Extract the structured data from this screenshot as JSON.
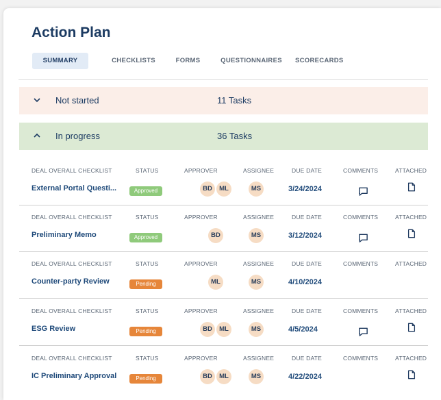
{
  "title": "Action Plan",
  "tabs": [
    "SUMMARY",
    "CHECKLISTS",
    "FORMS",
    "QUESTIONNAIRES",
    "SCORECARDS"
  ],
  "active_tab": "SUMMARY",
  "groups": [
    {
      "label": "Not started",
      "count": "11 Tasks",
      "expanded": false,
      "color": "#fbeee8"
    },
    {
      "label": "In progress",
      "count": "36 Tasks",
      "expanded": true,
      "color": "#dcead4"
    }
  ],
  "columns": {
    "checklist": "DEAL OVERALL CHECKLIST",
    "status": "STATUS",
    "approver": "APPROVER",
    "assignee": "ASSIGNEE",
    "due": "DUE DATE",
    "comments": "COMMENTS",
    "attached": "ATTACHED"
  },
  "status_colors": {
    "Approved": "#8fca7b",
    "Pending": "#e6863a"
  },
  "rows": [
    {
      "name": "External Portal Questi...",
      "status": "Approved",
      "approvers": [
        "BD",
        "ML"
      ],
      "assignee": "MS",
      "due": "3/24/2024",
      "comment_icon": "comment-icon",
      "attach_icon": "document-icon"
    },
    {
      "name": "Preliminary Memo",
      "status": "Approved",
      "approvers": [
        "BD"
      ],
      "assignee": "MS",
      "due": "3/12/2024",
      "comment_icon": "comment-icon",
      "attach_icon": "document-icon"
    },
    {
      "name": "Counter-party Review",
      "status": "Pending",
      "approvers": [
        "ML"
      ],
      "assignee": "MS",
      "due": "4/10/2024"
    },
    {
      "name": "ESG Review",
      "status": "Pending",
      "approvers": [
        "BD",
        "ML"
      ],
      "assignee": "MS",
      "due": "4/5/2024",
      "comment_icon": "comment-icon",
      "attach_icon": "document-icon"
    },
    {
      "name": "IC Preliminary Approval",
      "status": "Pending",
      "approvers": [
        "BD",
        "ML"
      ],
      "assignee": "MS",
      "due": "4/22/2024",
      "attach_icon": "document-icon"
    }
  ]
}
